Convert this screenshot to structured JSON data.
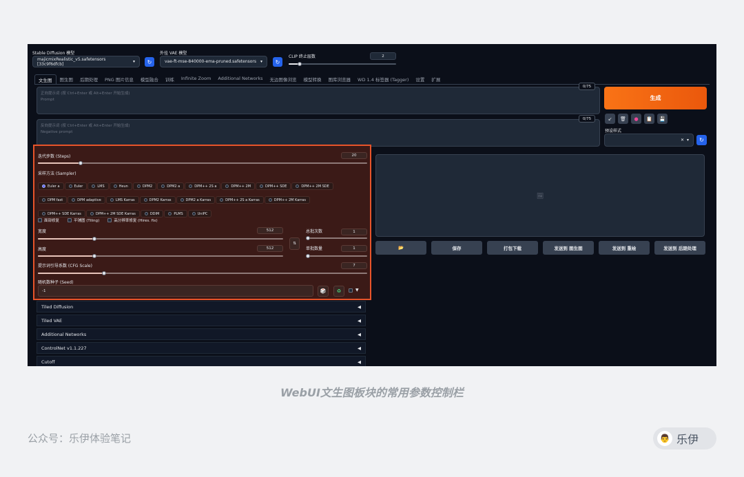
{
  "header": {
    "sd_model_label": "Stable Diffusion 模型",
    "sd_model_value": "majicmixRealistic_v5.safetensors [33c9f6dfcb]",
    "vae_label": "外挂 VAE 模型",
    "vae_value": "vae-ft-mse-840000-ema-pruned.safetensors",
    "clip_label": "CLIP 终止层数",
    "clip_value": "2",
    "clip_fraction": 0.1,
    "refresh_icon": "refresh-icon"
  },
  "tabs": [
    "文生图",
    "图生图",
    "后期处理",
    "PNG 图片信息",
    "模型融合",
    "训练",
    "Infinite Zoom",
    "Additional Networks",
    "无边图像浏览",
    "模型转换",
    "图库浏览器",
    "WD 1.4 标签器 (Tagger)",
    "设置",
    "扩展"
  ],
  "prompt": {
    "placeholder_cn": "正向提示词 (按 Ctrl+Enter 或 Alt+Enter 开始生成)",
    "placeholder_en": "Prompt",
    "counter": "0/75"
  },
  "negative": {
    "placeholder_cn": "反向提示词 (按 Ctrl+Enter 或 Alt+Enter 开始生成)",
    "placeholder_en": "Negative prompt",
    "counter": "0/75"
  },
  "generate_label": "生成",
  "tools": [
    "↙",
    "🗑",
    "●",
    "📋",
    "💾"
  ],
  "style_label": "预设样式",
  "params": {
    "steps_label": "迭代步数 (Steps)",
    "steps_value": "20",
    "steps_fraction": 0.13,
    "sampler_label": "采样方法 (Sampler)",
    "samplers_row1": [
      "Euler a",
      "Euler",
      "LMS",
      "Heun",
      "DPM2",
      "DPM2 a",
      "DPM++ 2S a",
      "DPM++ 2M",
      "DPM++ SDE",
      "DPM++ 2M SDE"
    ],
    "samplers_row2": [
      "DPM fast",
      "DPM adaptive",
      "LMS Karras",
      "DPM2 Karras",
      "DPM2 a Karras",
      "DPM++ 2S a Karras",
      "DPM++ 2M Karras"
    ],
    "samplers_row3": [
      "DPM++ SDE Karras",
      "DPM++ 2M SDE Karras",
      "DDIM",
      "PLMS",
      "UniPC"
    ],
    "selected_sampler": "Euler a",
    "face_fix": "面部修复",
    "tiling": "平铺图 (Tiling)",
    "hires_fix": "高分辨率修复 (Hires. fix)",
    "width_label": "宽度",
    "width_value": "512",
    "width_fraction": 0.23,
    "height_label": "高度",
    "height_value": "512",
    "height_fraction": 0.23,
    "batch_count_label": "总批次数",
    "batch_count_value": "1",
    "batch_size_label": "单批数量",
    "batch_size_value": "1",
    "cfg_label": "提示词引导系数 (CFG Scale)",
    "cfg_value": "7",
    "cfg_fraction": 0.2,
    "seed_label": "随机数种子 (Seed)",
    "seed_value": "-1",
    "swap_icon": "⇅",
    "dice_icon": "🎲",
    "recycle_icon": "♻",
    "dropdown_arrow": "▼"
  },
  "accordions": [
    "Tiled Diffusion",
    "Tiled VAE",
    "Additional Networks",
    "ControlNet v1.1.227",
    "Cutoff"
  ],
  "accordion_arrow": "◀",
  "output": {
    "image_icon": "🖼",
    "actions": [
      "📂",
      "保存",
      "打包下载",
      "发送到 图生图",
      "发送到 重绘",
      "发送到 后期处理"
    ]
  },
  "caption": "WebUI文生图板块的常用参数控制栏",
  "footer_left": "公众号：乐伊体验笔记",
  "badge_name": "乐伊",
  "avatar_glyph": "👨"
}
